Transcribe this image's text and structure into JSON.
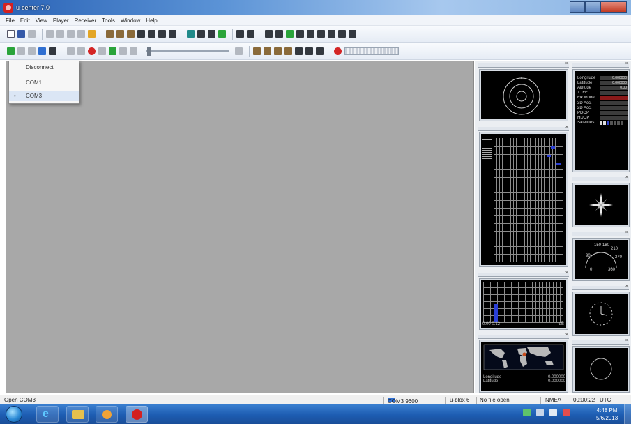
{
  "window": {
    "title": "u-center 7.0",
    "controls": {
      "minimize": "",
      "maximize": "",
      "close": ""
    }
  },
  "menu": [
    "File",
    "Edit",
    "View",
    "Player",
    "Receiver",
    "Tools",
    "Window",
    "Help"
  ],
  "connection_menu": {
    "items": [
      {
        "label": "Disconnect",
        "selected": false
      },
      {
        "label": "COM1",
        "selected": false
      },
      {
        "label": "COM3",
        "selected": true
      }
    ],
    "bullet": "•"
  },
  "data_view": {
    "rows": [
      {
        "label": "Longitude",
        "value": "0.000000"
      },
      {
        "label": "Latitude",
        "value": "0.000000"
      },
      {
        "label": "Altitude",
        "value": "0.00"
      },
      {
        "label": "TTFF",
        "value": ""
      },
      {
        "label": "Fix Mode",
        "value": ""
      },
      {
        "label": "3D Acc.",
        "value": ""
      },
      {
        "label": "2D Acc.",
        "value": ""
      },
      {
        "label": "PDOP",
        "value": ""
      },
      {
        "label": "HDOP",
        "value": ""
      },
      {
        "label": "Satellites",
        "value": ""
      }
    ],
    "fix_mode_color": "#8a1a1a"
  },
  "map_view": {
    "rows": [
      {
        "label": "Longitude",
        "value": "0.000000"
      },
      {
        "label": "Latitude",
        "value": "0.000000"
      }
    ]
  },
  "signal_view": {
    "axis_left": "0.00 0.12",
    "axis_right": "dB"
  },
  "compass_view": {
    "labels": [
      "150",
      "180",
      "210",
      "90",
      "270",
      "0",
      "360"
    ]
  },
  "statusbar": {
    "left": "Open COM3",
    "port": "COM3 9600",
    "protocol": "u-blox 6",
    "file": "No file open",
    "nmea": "NMEA",
    "time": "00:00:22",
    "utc": "UTC"
  },
  "taskbar": {
    "time": "4:48 PM",
    "date": "5/6/2013"
  },
  "colors": {
    "workspace": "#a8a8a8",
    "panel_bg": "#000000",
    "accent": "#2a63b6"
  }
}
